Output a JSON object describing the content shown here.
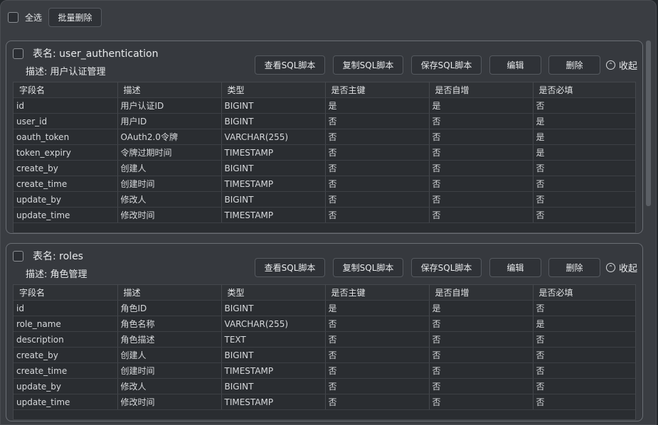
{
  "toolbar": {
    "select_all_label": "全选",
    "batch_delete_label": "批量删除"
  },
  "columns": [
    "字段名",
    "描述",
    "类型",
    "是否主键",
    "是否自增",
    "是否必填"
  ],
  "actions": {
    "view_sql": "查看SQL脚本",
    "copy_sql": "复制SQL脚本",
    "save_sql": "保存SQL脚本",
    "edit": "编辑",
    "delete": "删除",
    "collapse": "收起"
  },
  "tables": [
    {
      "name": "表名: user_authentication",
      "description": "描述: 用户认证管理",
      "rows": [
        [
          "id",
          "用户认证ID",
          "BIGINT",
          "是",
          "是",
          "否"
        ],
        [
          "user_id",
          "用户ID",
          "BIGINT",
          "否",
          "否",
          "是"
        ],
        [
          "oauth_token",
          "OAuth2.0令牌",
          "VARCHAR(255)",
          "否",
          "否",
          "是"
        ],
        [
          "token_expiry",
          "令牌过期时间",
          "TIMESTAMP",
          "否",
          "否",
          "是"
        ],
        [
          "create_by",
          "创建人",
          "BIGINT",
          "否",
          "否",
          "否"
        ],
        [
          "create_time",
          "创建时间",
          "TIMESTAMP",
          "否",
          "否",
          "否"
        ],
        [
          "update_by",
          "修改人",
          "BIGINT",
          "否",
          "否",
          "否"
        ],
        [
          "update_time",
          "修改时间",
          "TIMESTAMP",
          "否",
          "否",
          "否"
        ]
      ]
    },
    {
      "name": "表名: roles",
      "description": "描述: 角色管理",
      "rows": [
        [
          "id",
          "角色ID",
          "BIGINT",
          "是",
          "是",
          "否"
        ],
        [
          "role_name",
          "角色名称",
          "VARCHAR(255)",
          "否",
          "否",
          "是"
        ],
        [
          "description",
          "角色描述",
          "TEXT",
          "否",
          "否",
          "否"
        ],
        [
          "create_by",
          "创建人",
          "BIGINT",
          "否",
          "否",
          "否"
        ],
        [
          "create_time",
          "创建时间",
          "TIMESTAMP",
          "否",
          "否",
          "否"
        ],
        [
          "update_by",
          "修改人",
          "BIGINT",
          "否",
          "否",
          "否"
        ],
        [
          "update_time",
          "修改时间",
          "TIMESTAMP",
          "否",
          "否",
          "否"
        ]
      ]
    }
  ]
}
